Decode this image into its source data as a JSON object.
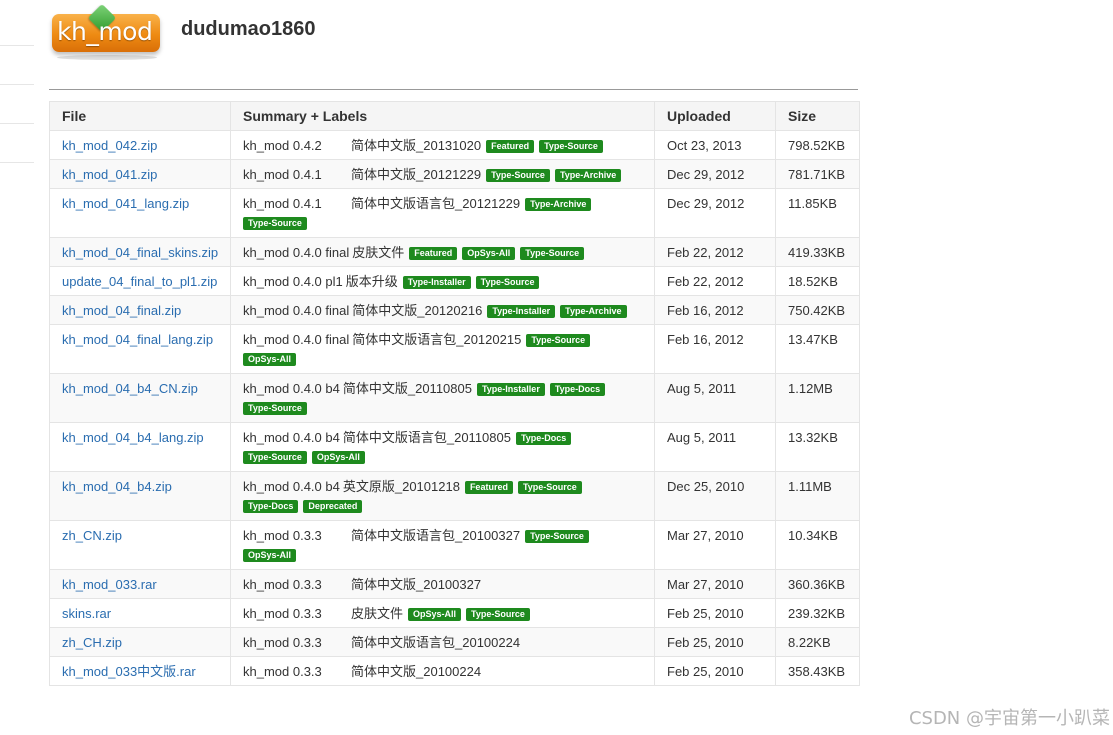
{
  "header": {
    "logo_text": "kh_mod",
    "project_name": "dudumao1860"
  },
  "table": {
    "columns": [
      "File",
      "Summary + Labels",
      "Uploaded",
      "Size"
    ],
    "rows": [
      {
        "file": "kh_mod_042.zip",
        "version": "kh_mod 0.4.2",
        "summary": "简体中文版_20131020",
        "labels": [
          "Featured",
          "Type-Source"
        ],
        "wrap": [],
        "uploaded": "Oct 23, 2013",
        "size": "798.52KB"
      },
      {
        "file": "kh_mod_041.zip",
        "version": "kh_mod 0.4.1",
        "summary": "简体中文版_20121229",
        "labels": [
          "Type-Source",
          "Type-Archive"
        ],
        "wrap": [],
        "uploaded": "Dec 29, 2012",
        "size": "781.71KB"
      },
      {
        "file": "kh_mod_041_lang.zip",
        "version": "kh_mod 0.4.1",
        "summary": "简体中文版语言包_20121229",
        "labels": [
          "Type-Archive"
        ],
        "wrap": [
          "Type-Source"
        ],
        "uploaded": "Dec 29, 2012",
        "size": "11.85KB"
      },
      {
        "file": "kh_mod_04_final_skins.zip",
        "version": "kh_mod 0.4.0 final",
        "summary": "皮肤文件",
        "labels": [
          "Featured",
          "OpSys-All",
          "Type-Source"
        ],
        "wrap": [],
        "uploaded": "Feb 22, 2012",
        "size": "419.33KB"
      },
      {
        "file": "update_04_final_to_pl1.zip",
        "version": "kh_mod 0.4.0 pl1",
        "summary": "版本升级",
        "labels": [
          "Type-Installer",
          "Type-Source"
        ],
        "wrap": [],
        "uploaded": "Feb 22, 2012",
        "size": "18.52KB"
      },
      {
        "file": "kh_mod_04_final.zip",
        "version": "kh_mod 0.4.0 final",
        "summary": "简体中文版_20120216",
        "labels": [
          "Type-Installer",
          "Type-Archive"
        ],
        "wrap": [],
        "uploaded": "Feb 16, 2012",
        "size": "750.42KB"
      },
      {
        "file": "kh_mod_04_final_lang.zip",
        "version": "kh_mod 0.4.0 final",
        "summary": "简体中文版语言包_20120215",
        "labels": [
          "Type-Source"
        ],
        "wrap": [
          "OpSys-All"
        ],
        "uploaded": "Feb 16, 2012",
        "size": "13.47KB"
      },
      {
        "file": "kh_mod_04_b4_CN.zip",
        "version": "kh_mod 0.4.0 b4",
        "summary": "简体中文版_20110805",
        "labels": [
          "Type-Installer",
          "Type-Docs"
        ],
        "wrap": [
          "Type-Source"
        ],
        "uploaded": "Aug 5, 2011",
        "size": "1.12MB"
      },
      {
        "file": "kh_mod_04_b4_lang.zip",
        "version": "kh_mod 0.4.0 b4",
        "summary": "简体中文版语言包_20110805",
        "labels": [
          "Type-Docs"
        ],
        "wrap": [
          "Type-Source",
          "OpSys-All"
        ],
        "uploaded": "Aug 5, 2011",
        "size": "13.32KB"
      },
      {
        "file": "kh_mod_04_b4.zip",
        "version": "kh_mod 0.4.0 b4",
        "summary": "英文原版_20101218",
        "labels": [
          "Featured",
          "Type-Source"
        ],
        "wrap": [
          "Type-Docs",
          "Deprecated"
        ],
        "uploaded": "Dec 25, 2010",
        "size": "1.11MB"
      },
      {
        "file": "zh_CN.zip",
        "version": "kh_mod 0.3.3",
        "summary": "简体中文版语言包_20100327",
        "labels": [
          "Type-Source"
        ],
        "wrap": [
          "OpSys-All"
        ],
        "uploaded": "Mar 27, 2010",
        "size": "10.34KB"
      },
      {
        "file": "kh_mod_033.rar",
        "version": "kh_mod 0.3.3",
        "summary": "简体中文版_20100327",
        "labels": [],
        "wrap": [],
        "uploaded": "Mar 27, 2010",
        "size": "360.36KB"
      },
      {
        "file": "skins.rar",
        "version": "kh_mod 0.3.3",
        "summary": "皮肤文件",
        "labels": [
          "OpSys-All",
          "Type-Source"
        ],
        "wrap": [],
        "uploaded": "Feb 25, 2010",
        "size": "239.32KB"
      },
      {
        "file": "zh_CH.zip",
        "version": "kh_mod 0.3.3",
        "summary": "简体中文版语言包_20100224",
        "labels": [],
        "wrap": [],
        "uploaded": "Feb 25, 2010",
        "size": "8.22KB"
      },
      {
        "file": "kh_mod_033中文版.rar",
        "version": "kh_mod 0.3.3",
        "summary": "简体中文版_20100224",
        "labels": [],
        "wrap": [],
        "uploaded": "Feb 25, 2010",
        "size": "358.43KB"
      }
    ]
  },
  "watermark": "CSDN @宇宙第一小趴菜",
  "colors": {
    "link": "#2a6db0",
    "badge": "#1e8a1e",
    "header_bg": "#f5f5f5",
    "logo_orange": "#ee8a12"
  }
}
